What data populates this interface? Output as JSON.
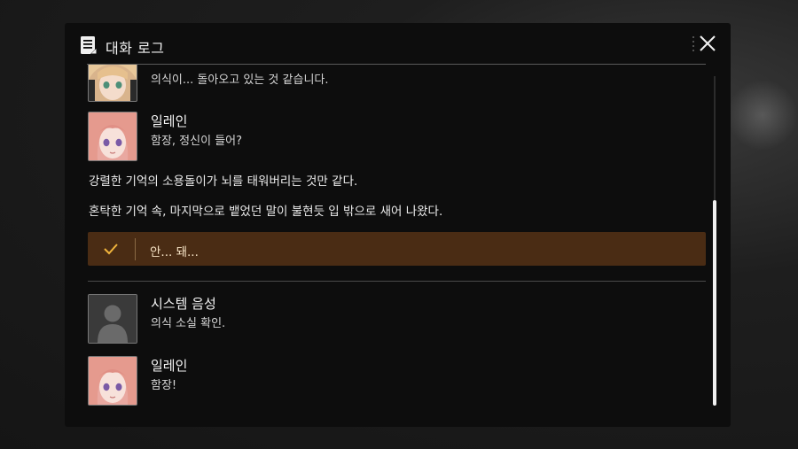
{
  "header": {
    "title": "대화 로그",
    "icon": "log-icon",
    "close_icon": "close-icon"
  },
  "entries_top": [
    {
      "line": "의식이... 돌아오고 있는 것 같습니다."
    },
    {
      "name": "일레인",
      "line": "함장, 정신이 들어?"
    }
  ],
  "narration": [
    "강렬한 기억의 소용돌이가 뇌를 태워버리는 것만 같다.",
    "혼탁한 기억 속, 마지막으로 뱉었던 말이 불현듯 입 밖으로 새어 나왔다."
  ],
  "choice": {
    "label": "안... 돼...",
    "icon": "check-icon"
  },
  "entries_bottom": [
    {
      "name": "시스템 음성",
      "line": "의식 소실 확인."
    },
    {
      "name": "일레인",
      "line": "함장!"
    }
  ],
  "colors": {
    "panel_bg": "#0d0d0d",
    "choice_bg": "#4a2c14",
    "choice_text": "#f5e2c4",
    "check": "#f0b43c"
  }
}
